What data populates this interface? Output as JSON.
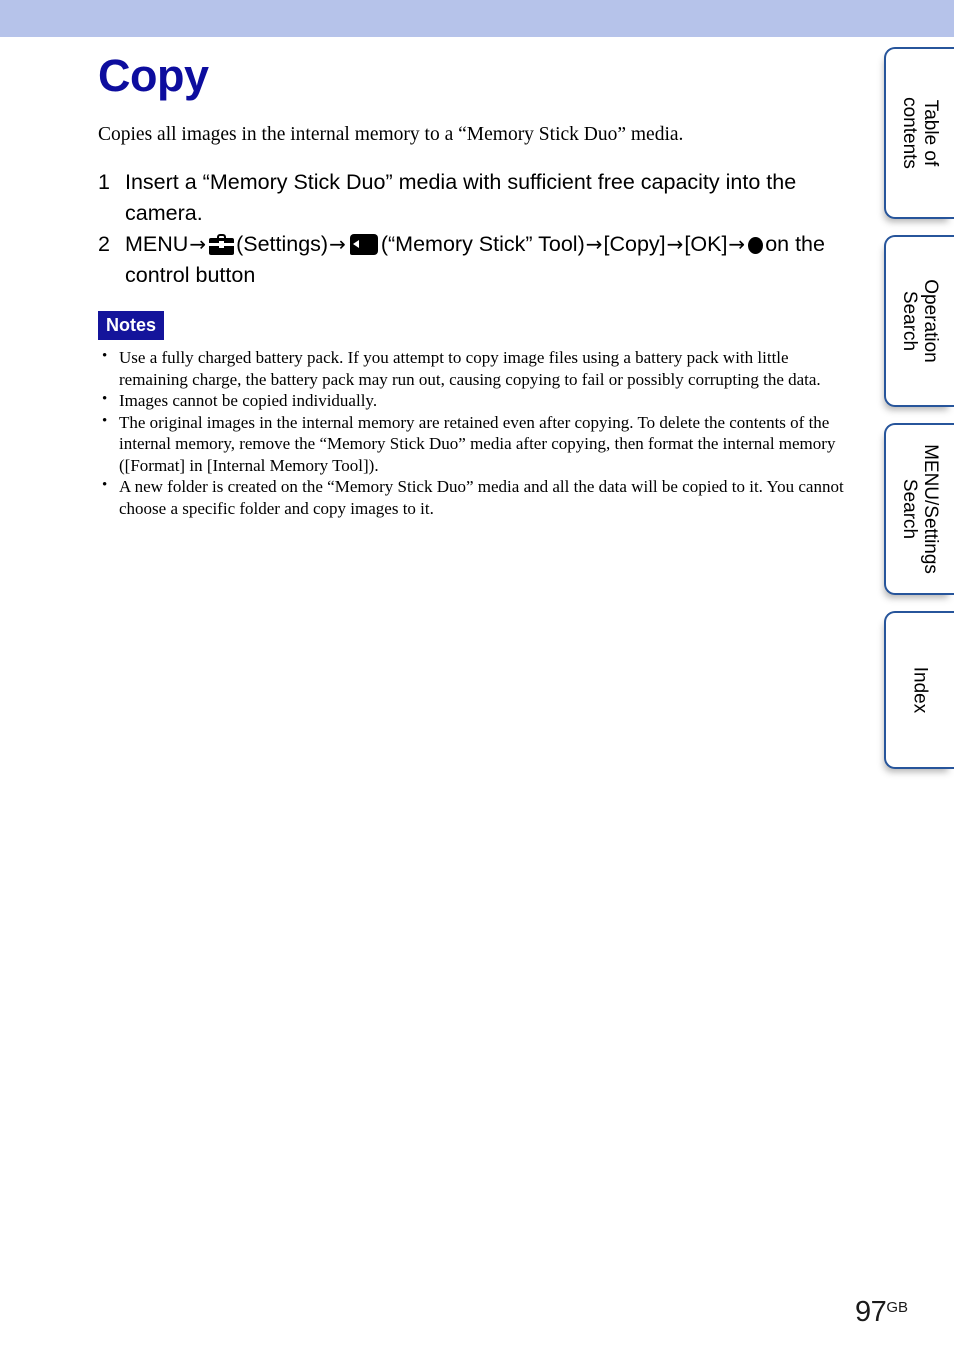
{
  "theme": {
    "top_band_color": "#b6c3ea",
    "title_color": "#0d0d9e",
    "notes_badge_bg": "#14149b",
    "tab_border_color": "#27559b"
  },
  "header": {
    "title": "Copy"
  },
  "main": {
    "intro": "Copies all images in the internal memory to a “Memory Stick Duo” media.",
    "steps": [
      {
        "number": "1",
        "text": "Insert a “Memory Stick Duo” media with sufficient free capacity into the camera."
      },
      {
        "number": "2",
        "parts": {
          "menu": "MENU",
          "arrow1": "→",
          "settings_icon": "toolbox-icon",
          "settings_label": "(Settings)",
          "arrow2": "→",
          "memory_stick_icon": "memory-stick-icon",
          "memory_stick_label": "(“Memory Stick” Tool)",
          "arrow3": "→",
          "copy_label": "[Copy]",
          "arrow4": "→",
          "ok_label": "[OK]",
          "arrow5": "→",
          "control_icon": "filled-circle-icon",
          "control_label": "on the control button"
        }
      }
    ],
    "notes": {
      "badge": "Notes",
      "bullet_glyph": "•",
      "items": [
        "Use a fully charged battery pack. If you attempt to copy image files using a battery pack with little remaining charge, the battery pack may run out, causing copying to fail or possibly corrupting the data.",
        "Images cannot be copied individually.",
        "The original images in the internal memory are retained even after copying. To delete the contents of the internal memory, remove the “Memory Stick Duo” media after copying, then format the internal memory ([Format] in [Internal Memory Tool]).",
        "A new folder is created on the “Memory Stick Duo” media and all the data will be copied to it. You cannot choose a specific folder and copy images to it."
      ]
    }
  },
  "side_tabs": [
    {
      "line1": "Table of",
      "line2": "contents"
    },
    {
      "line1": "Operation",
      "line2": "Search"
    },
    {
      "line1": "MENU/Settings",
      "line2": "Search"
    },
    {
      "line1": "Index",
      "line2": ""
    }
  ],
  "footer": {
    "page_number": "97",
    "page_suffix": "GB"
  }
}
